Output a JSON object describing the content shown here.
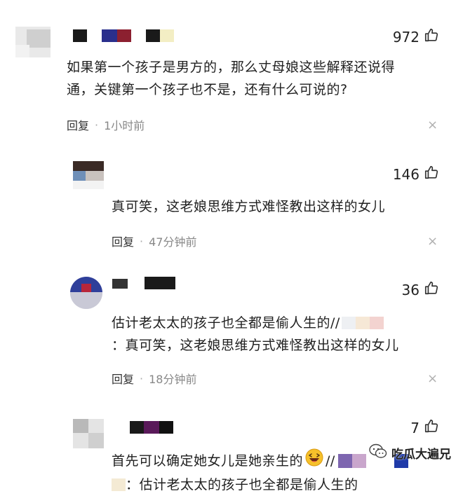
{
  "comments": [
    {
      "likes": "972",
      "text_line1": "如果第一个孩子是男方的，那么丈母娘这些解释还说得",
      "text_line2": "通，关键第一个孩子也不是，还有什么可说的?",
      "reply_label": "回复",
      "separator": "·",
      "time": "1小时前",
      "close_icon": "×"
    },
    {
      "likes": "146",
      "text_line1": "真可笑，这老娘思维方式难怪教出这样的女儿",
      "reply_label": "回复",
      "separator": "·",
      "time": "47分钟前",
      "close_icon": "×"
    },
    {
      "likes": "36",
      "text_line1": "估计老太太的孩子也全都是偷人生的//",
      "text_line2": "：真可笑，这老娘思维方式难怪教出这样的女儿",
      "reply_label": "回复",
      "separator": "·",
      "time": "18分钟前",
      "close_icon": "×"
    },
    {
      "likes": "7",
      "text_line1": "首先可以确定她女儿是她亲生的",
      "text_line1_suffix": "//",
      "text_line2": "：估计老太太的孩子也全都是偷人生的"
    }
  ],
  "watermark": {
    "text": "吃瓜大遍兄"
  },
  "colors": {
    "text": "#1f1f1f",
    "meta_time": "#888888",
    "close": "#b0b0b0",
    "like_icon": "#333333"
  },
  "icons": {
    "like": "thumbs-up-icon",
    "close": "close-icon",
    "emoji": "laughing-emoji-icon",
    "watermark": "wechat-logo-icon"
  }
}
